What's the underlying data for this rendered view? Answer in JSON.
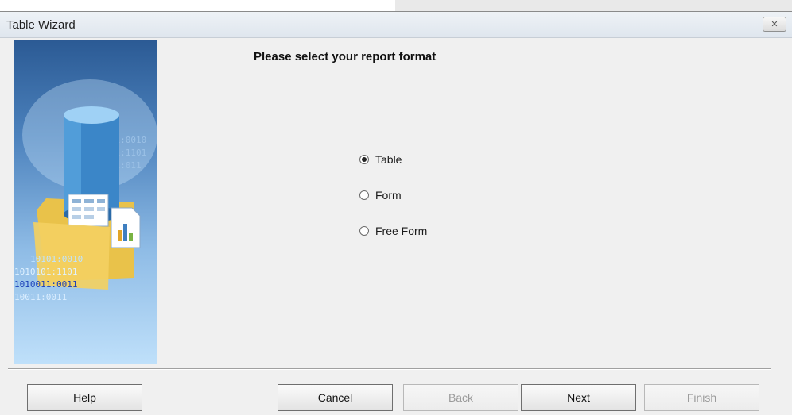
{
  "window": {
    "title": "Table Wizard"
  },
  "title_bar": {
    "close_icon": "close-icon"
  },
  "panel": {
    "binary_lines": [
      "10101:0010",
      "10011:1101",
      "10111:011",
      "10101:0010",
      "1010101:1101",
      "1010011:0011",
      "10011:0011"
    ]
  },
  "main": {
    "heading": "Please select your report format",
    "options": [
      {
        "label": "Table",
        "selected": true
      },
      {
        "label": "Form",
        "selected": false
      },
      {
        "label": "Free Form",
        "selected": false
      }
    ]
  },
  "footer": {
    "help": "Help",
    "cancel": "Cancel",
    "back": "Back",
    "next": "Next",
    "finish": "Finish",
    "back_enabled": false,
    "finish_enabled": false
  },
  "colors": {
    "dialog_bg": "#f0f0f0",
    "panel_top": "#2b5a94",
    "panel_bottom": "#bfe0fa"
  }
}
